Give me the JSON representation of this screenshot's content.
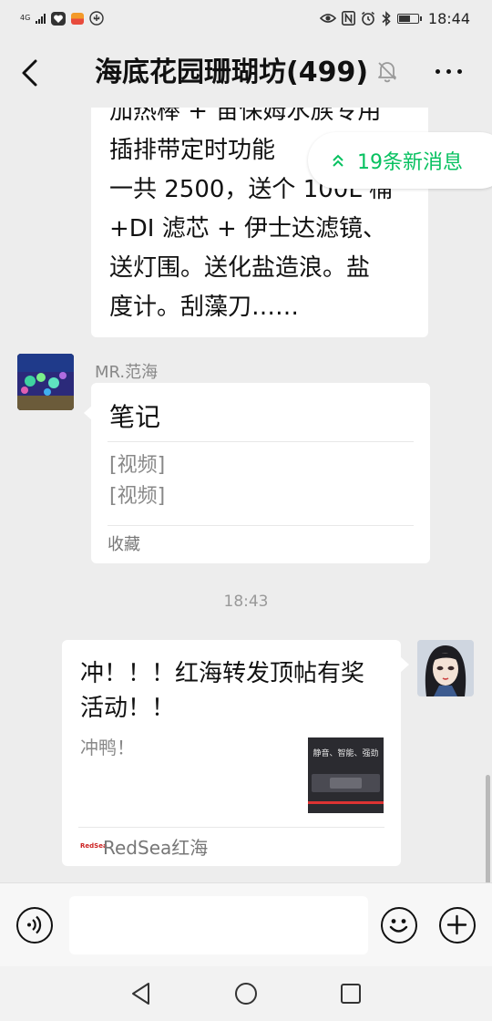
{
  "status_bar": {
    "network": "4G",
    "time": "18:44",
    "icons": [
      "signal-icon",
      "heart-app-icon",
      "app-icon",
      "usb-icon",
      "eye-icon",
      "nfc-icon",
      "alarm-icon",
      "bluetooth-icon",
      "battery-icon"
    ],
    "battery_level": 0.65
  },
  "header": {
    "title": "海底花园珊瑚坊(499)",
    "icons": [
      "back-icon",
      "mute-bell-icon",
      "more-icon"
    ]
  },
  "new_messages": {
    "label": "19条新消息",
    "color": "#07c160"
  },
  "messages": {
    "first": {
      "lines": [
        "加热棒 + 宙保姆水族专用",
        "插排带定时功能",
        "一共 2500，送个 100L 桶",
        "+DI 滤芯 + 伊士达滤镜、",
        "送灯围。送化盐造浪。盐",
        "度计。刮藻刀……"
      ]
    },
    "second": {
      "sender": "MR.范海",
      "card_title": "笔记",
      "items": [
        "[视频]",
        "[视频]"
      ],
      "footer": "收藏"
    },
    "timestamp": "18:43",
    "third": {
      "title": "冲！！！红海转发顶帖有奖活动！！",
      "description": "冲鸭！",
      "thumbnail_text": "静音、智能、强劲",
      "source_logo": "RedSea",
      "source": "RedSea红海"
    }
  },
  "input_bar": {
    "icons": [
      "voice-icon",
      "emoji-icon",
      "plus-icon"
    ],
    "placeholder": ""
  },
  "nav_bar": {
    "icons": [
      "nav-back-icon",
      "nav-home-icon",
      "nav-recent-icon"
    ]
  },
  "colors": {
    "background": "#ededed",
    "bubble": "#ffffff",
    "accent": "#07c160"
  }
}
